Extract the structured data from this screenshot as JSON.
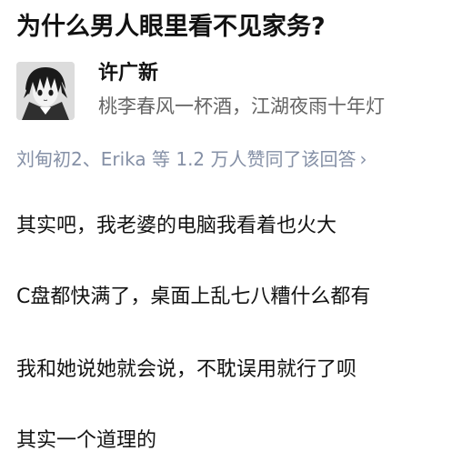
{
  "question": {
    "title": "为什么男人眼里看不见家务?"
  },
  "author": {
    "name": "许广新",
    "bio": "桃李春风一杯酒，江湖夜雨十年灯",
    "avatar_icon": "anime-avatar-icon"
  },
  "voters": {
    "text": "刘甸初2、Erika 等 1.2 万人赞同了该回答",
    "chevron": "›"
  },
  "answer": {
    "paragraphs": [
      "其实吧，我老婆的电脑我看着也火大",
      "C盘都快满了，桌面上乱七八糟什么都有",
      "我和她说她就会说，不耽误用就行了呗",
      "其实一个道理的"
    ]
  },
  "colors": {
    "text_primary": "#121212",
    "text_secondary": "#646464",
    "text_meta": "#8590a6"
  }
}
